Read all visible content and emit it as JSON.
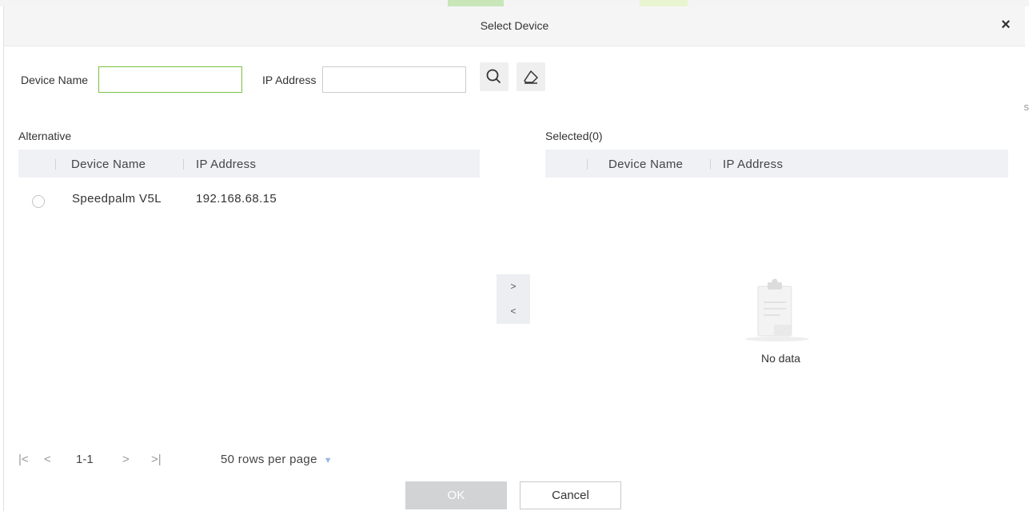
{
  "dialog": {
    "title": "Select Device",
    "close_icon": "close-icon"
  },
  "filter": {
    "device_name_label": "Device Name",
    "device_name_value": "",
    "ip_address_label": "IP Address",
    "ip_address_value": "",
    "search_icon": "search-icon",
    "clear_icon": "eraser-icon"
  },
  "alternative": {
    "label": "Alternative",
    "columns": [
      "Device Name",
      "IP Address"
    ],
    "rows": [
      {
        "device_name": "Speedpalm V5L",
        "ip_address": "192.168.68.15",
        "selected": false
      }
    ]
  },
  "selected_panel": {
    "label": "Selected(0)",
    "columns": [
      "Device Name",
      "IP Address"
    ],
    "empty_text": "No data"
  },
  "transfer": {
    "move_right": ">",
    "move_left": "<"
  },
  "pagination": {
    "first": "|<",
    "prev": "<",
    "range": "1-1",
    "next": ">",
    "last": ">|",
    "rows_per_page": "50 rows per page"
  },
  "footer": {
    "ok_label": "OK",
    "cancel_label": "Cancel"
  },
  "colors": {
    "focus_border": "#7ac143",
    "header_bg": "#eff1f5",
    "ok_disabled_bg": "#d2d3d5"
  }
}
